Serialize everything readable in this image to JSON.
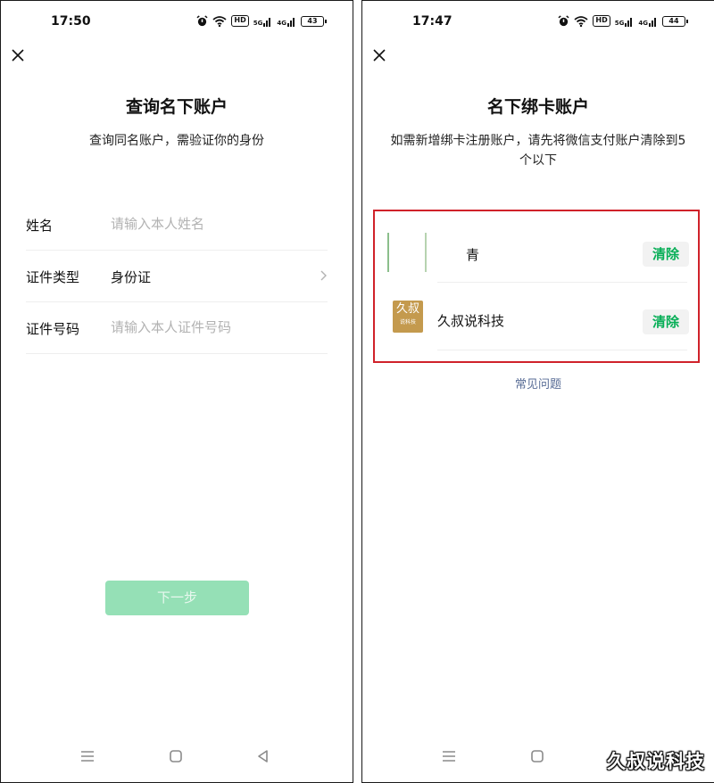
{
  "left_screen": {
    "status": {
      "time": "17:50",
      "hd": "HD",
      "signal_1": "5G",
      "signal_2": "4G",
      "battery": "43"
    },
    "title": "查询名下账户",
    "subtitle": "查询同名账户，需验证你的身份",
    "form": {
      "name_label": "姓名",
      "name_placeholder": "请输入本人姓名",
      "id_type_label": "证件类型",
      "id_type_value": "身份证",
      "id_number_label": "证件号码",
      "id_number_placeholder": "请输入本人证件号码"
    },
    "next_button": "下一步"
  },
  "right_screen": {
    "status": {
      "time": "17:47",
      "hd": "HD",
      "signal_1": "5G",
      "signal_2": "4G",
      "battery": "44"
    },
    "title": "名下绑卡账户",
    "subtitle": "如需新增绑卡注册账户，请先将微信支付账户清除到5个以下",
    "accounts": [
      {
        "name": "青",
        "clear_label": "清除"
      },
      {
        "name": "久叔说科技",
        "avatar_text": "久叔",
        "avatar_subtext": "说科技",
        "clear_label": "清除"
      }
    ],
    "faq_link": "常见问题"
  },
  "watermark": "久叔说科技",
  "colors": {
    "accent_green": "#06ae56",
    "disabled_button": "#95e0b6",
    "link_blue": "#576b95",
    "highlight_border": "#d0222a"
  }
}
